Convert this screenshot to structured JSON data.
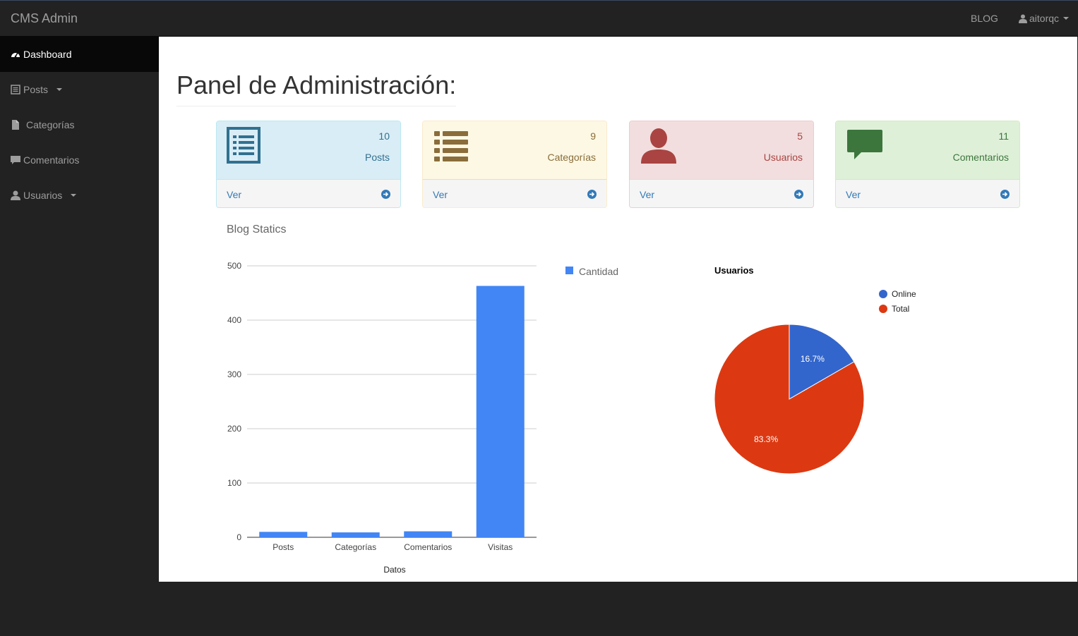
{
  "header": {
    "brand": "CMS Admin",
    "blog_link": "BLOG",
    "user": "aitorqc"
  },
  "sidebar": {
    "items": [
      {
        "label": "Dashboard",
        "icon": "dashboard-icon",
        "active": true
      },
      {
        "label": "Posts",
        "icon": "list-alt-icon",
        "dropdown": true
      },
      {
        "label": "Categorías",
        "icon": "file-icon"
      },
      {
        "label": "Comentarios",
        "icon": "comment-icon"
      },
      {
        "label": "Usuarios",
        "icon": "user-icon",
        "dropdown": true
      }
    ]
  },
  "main": {
    "title": "Panel de Administración:",
    "cards": [
      {
        "count": "10",
        "label": "Posts",
        "link": "Ver",
        "icon": "list-alt-icon",
        "color": "#31708f",
        "bg": "#d9edf7",
        "border": "#bce8f1"
      },
      {
        "count": "9",
        "label": "Categorías",
        "link": "Ver",
        "icon": "list-icon",
        "color": "#8a6d3b",
        "bg": "#fcf8e3",
        "border": "#faebcc"
      },
      {
        "count": "5",
        "label": "Usuarios",
        "link": "Ver",
        "icon": "user-icon",
        "color": "#a94442",
        "bg": "#f2dede",
        "border": "#ebccd1"
      },
      {
        "count": "11",
        "label": "Comentarios",
        "link": "Ver",
        "icon": "comment-icon",
        "color": "#3c763d",
        "bg": "#dff0d8",
        "border": "#d6e9c6"
      }
    ],
    "link_color": "#337ab7",
    "stats_title": "Blog Statics"
  },
  "chart_data": [
    {
      "type": "bar",
      "categories": [
        "Posts",
        "Categorías",
        "Comentarios",
        "Visitas"
      ],
      "series": [
        {
          "name": "Cantidad",
          "values": [
            10,
            9,
            11,
            463
          ],
          "color": "#4285f4"
        }
      ],
      "xlabel": "Datos",
      "ylabel": "",
      "ylim": [
        0,
        500
      ],
      "yticks": [
        0,
        100,
        200,
        300,
        400,
        500
      ],
      "grid": true,
      "legend": "right"
    },
    {
      "type": "pie",
      "title": "Usuarios",
      "labels": [
        "Online",
        "Total"
      ],
      "values": [
        1,
        5
      ],
      "percent_labels": [
        "16.7%",
        "83.3%"
      ],
      "colors": [
        "#3366cc",
        "#dc3912"
      ],
      "legend": "top-right"
    }
  ]
}
